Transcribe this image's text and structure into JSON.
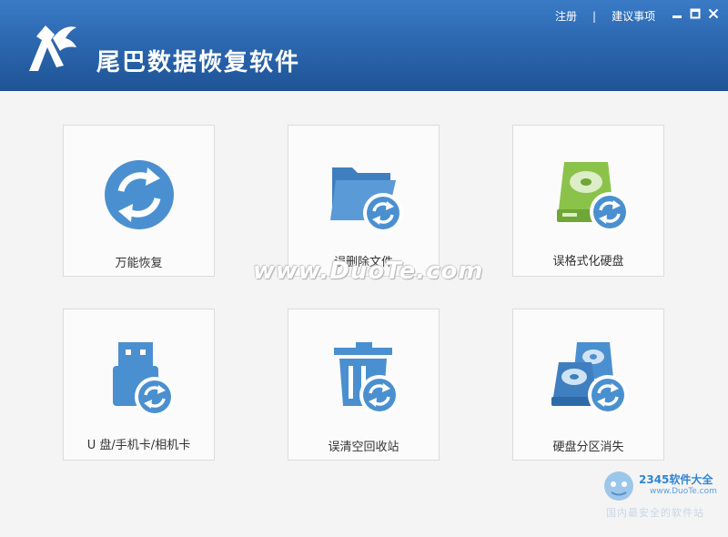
{
  "app": {
    "title": "尾巴数据恢复软件"
  },
  "header": {
    "links": {
      "register": "注册",
      "separator": "|",
      "feedback": "建议事项"
    },
    "window_controls": [
      "minimize-icon",
      "maximize-icon",
      "close-icon"
    ]
  },
  "tiles": [
    {
      "label": "万能恢复",
      "icon": "universal-recover-icon"
    },
    {
      "label": "误删除文件",
      "icon": "deleted-file-folder-icon"
    },
    {
      "label": "误格式化硬盘",
      "icon": "formatted-drive-icon"
    },
    {
      "label": "U 盘/手机卡/相机卡",
      "icon": "usb-drive-icon"
    },
    {
      "label": "误清空回收站",
      "icon": "recycle-bin-icon"
    },
    {
      "label": "硬盘分区消失",
      "icon": "lost-partition-icon"
    }
  ],
  "watermark": {
    "text": "www.DuoTe.com"
  },
  "corner_brand": {
    "name": "2345软件大全",
    "url": "www.DuoTe.com",
    "slogan": "国内最安全的软件站"
  },
  "colors": {
    "header": "#2c68b0",
    "icon_blue": "#4a90d0",
    "icon_green": "#8bc34a",
    "background": "#f4f4f4"
  }
}
